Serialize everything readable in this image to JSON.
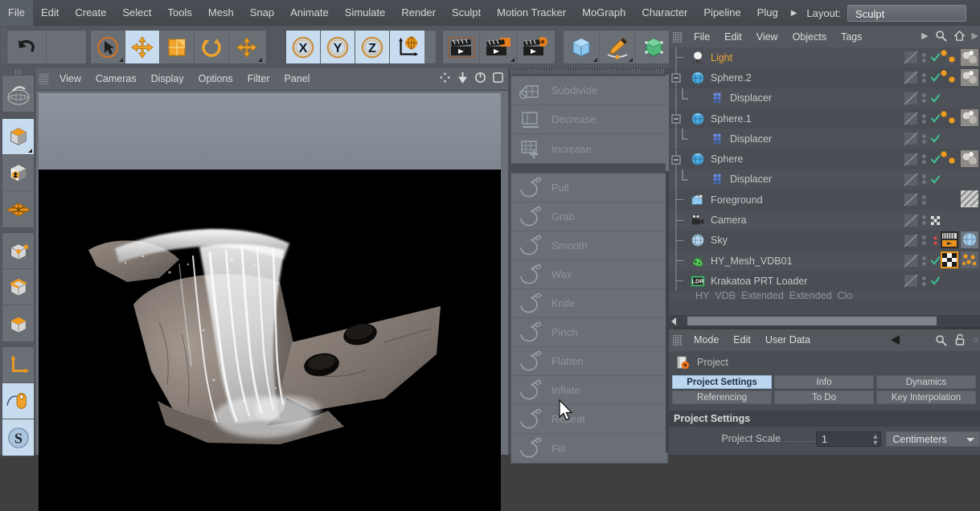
{
  "menubar": {
    "items": [
      "File",
      "Edit",
      "Create",
      "Select",
      "Tools",
      "Mesh",
      "Snap",
      "Animate",
      "Simulate",
      "Render",
      "Sculpt",
      "Motion Tracker",
      "MoGraph",
      "Character",
      "Pipeline",
      "Plug"
    ],
    "overflow_arrow": "▶",
    "layout_label": "Layout:",
    "layout_value": "Sculpt"
  },
  "toolbar": {
    "undo": "undo-arrow",
    "tools": [
      {
        "name": "live-selection-tool",
        "selected": false
      },
      {
        "name": "move-tool",
        "selected": true
      },
      {
        "name": "scale-tool",
        "selected": false
      },
      {
        "name": "rotate-tool",
        "selected": false
      },
      {
        "name": "move-axis-tool",
        "selected": false
      }
    ],
    "axes": [
      {
        "label": "X",
        "active": true
      },
      {
        "label": "Y",
        "active": true
      },
      {
        "label": "Z",
        "active": true
      }
    ],
    "world_axis": "world-coordinate-icon",
    "render_buttons": [
      "render-view",
      "render-region",
      "render-settings"
    ],
    "primitives": [
      "cube-primitive",
      "spline-pen",
      "deformer"
    ]
  },
  "left_toolbar": {
    "items": [
      {
        "name": "make-editable",
        "selected": false
      },
      {
        "name": "model-mode",
        "selected": true
      },
      {
        "name": "texture-mode",
        "selected": false
      },
      {
        "name": "polygon-mode",
        "selected": false
      },
      {
        "name": "point-mode",
        "selected": false
      },
      {
        "name": "edge-mode",
        "selected": false
      },
      {
        "name": "polygon-face-mode",
        "selected": false
      },
      {
        "name": "axis-mode",
        "selected": false
      },
      {
        "name": "viewport-solo",
        "selected": true
      },
      {
        "name": "sculpt-symmetry",
        "selected": true,
        "glyph": "S"
      }
    ]
  },
  "viewport": {
    "menu": [
      "View",
      "Cameras",
      "Display",
      "Options",
      "Filter",
      "Panel"
    ],
    "corner_icons": [
      "pan-icon",
      "move-down-icon",
      "rotate-icon",
      "maximize-icon"
    ],
    "render_description": "rendered waterfall over rocky cliff on black background"
  },
  "sculpt_panel": {
    "groups": [
      {
        "items": [
          {
            "label": "Subdivide",
            "icon": "subdivide-icon"
          },
          {
            "label": "Decrease",
            "icon": "decrease-icon"
          },
          {
            "label": "Increase",
            "icon": "increase-icon"
          }
        ]
      },
      {
        "items": [
          {
            "label": "Pull",
            "icon": "pull-brush-icon"
          },
          {
            "label": "Grab",
            "icon": "grab-brush-icon"
          },
          {
            "label": "Smooth",
            "icon": "smooth-brush-icon"
          },
          {
            "label": "Wax",
            "icon": "wax-brush-icon"
          },
          {
            "label": "Knife",
            "icon": "knife-brush-icon"
          },
          {
            "label": "Pinch",
            "icon": "pinch-brush-icon"
          },
          {
            "label": "Flatten",
            "icon": "flatten-brush-icon"
          },
          {
            "label": "Inflate",
            "icon": "inflate-brush-icon"
          },
          {
            "label": "Repeat",
            "icon": "repeat-brush-icon"
          },
          {
            "label": "Fill",
            "icon": "fill-brush-icon"
          }
        ]
      }
    ]
  },
  "object_manager": {
    "menu": [
      "File",
      "Edit",
      "View",
      "Objects",
      "Tags"
    ],
    "overflow_arrow": "▶",
    "icons": [
      "search-icon",
      "home-icon"
    ],
    "objects": [
      {
        "label": "Light",
        "icon": "light-icon",
        "depth": 0,
        "expandable": false,
        "highlight": true,
        "visdots": true,
        "check": "green",
        "tags": [
          "material-orange",
          "texture-thumb"
        ]
      },
      {
        "label": "Sphere.2",
        "icon": "sphere-icon",
        "depth": 0,
        "expandable": true,
        "highlight": false,
        "visdots": true,
        "check": "green",
        "tags": [
          "material-orange",
          "texture-thumb"
        ]
      },
      {
        "label": "Displacer",
        "icon": "displacer-icon",
        "depth": 1,
        "expandable": false,
        "highlight": false,
        "visdots": true,
        "check": "green",
        "tags": []
      },
      {
        "label": "Sphere.1",
        "icon": "sphere-icon",
        "depth": 0,
        "expandable": true,
        "highlight": false,
        "visdots": true,
        "check": "green",
        "tags": [
          "material-orange",
          "texture-thumb"
        ]
      },
      {
        "label": "Displacer",
        "icon": "displacer-icon",
        "depth": 1,
        "expandable": false,
        "highlight": false,
        "visdots": true,
        "check": "green",
        "tags": []
      },
      {
        "label": "Sphere",
        "icon": "sphere-icon",
        "depth": 0,
        "expandable": true,
        "highlight": false,
        "visdots": true,
        "check": "green",
        "tags": [
          "material-orange",
          "texture-thumb"
        ]
      },
      {
        "label": "Displacer",
        "icon": "displacer-icon",
        "depth": 1,
        "expandable": false,
        "highlight": false,
        "visdots": true,
        "check": "green",
        "tags": []
      },
      {
        "label": "Foreground",
        "icon": "foreground-icon",
        "depth": 0,
        "expandable": false,
        "highlight": false,
        "visdots": true,
        "check": "none",
        "tags": [
          "hatch-thumb"
        ]
      },
      {
        "label": "Camera",
        "icon": "camera-icon",
        "depth": 0,
        "expandable": false,
        "highlight": false,
        "visdots": true,
        "check": "dots",
        "tags": []
      },
      {
        "label": "Sky",
        "icon": "sky-icon",
        "depth": 0,
        "expandable": false,
        "highlight": false,
        "visdots": true,
        "check": "red",
        "tags": [
          "compositing-tag",
          "sky-thumb"
        ]
      },
      {
        "label": "HY_Mesh_VDB01",
        "icon": "vdb-mesh-icon",
        "depth": 0,
        "expandable": false,
        "highlight": false,
        "visdots": true,
        "check": "green",
        "tags": [
          "checker-thumb",
          "particle-thumb"
        ]
      },
      {
        "label": "Krakatoa PRT Loader",
        "icon": "prt-loader-icon",
        "depth": 0,
        "expandable": false,
        "highlight": false,
        "visdots": true,
        "check": "green",
        "tags": []
      }
    ]
  },
  "attributes": {
    "menu": [
      "Mode",
      "Edit",
      "User Data"
    ],
    "icons": [
      "back-arrow-icon",
      "forward-arrow-icon",
      "search-icon",
      "lock-icon"
    ],
    "object_title": "Project",
    "object_icon": "project-icon",
    "tabs_row1": [
      {
        "label": "Project Settings",
        "active": true
      },
      {
        "label": "Info",
        "active": false
      },
      {
        "label": "Dynamics",
        "active": false
      }
    ],
    "tabs_row2": [
      {
        "label": "Referencing",
        "active": false
      },
      {
        "label": "To Do",
        "active": false
      },
      {
        "label": "Key Interpolation",
        "active": false
      }
    ],
    "section_header": "Project Settings",
    "properties": [
      {
        "label": "Project Scale",
        "value": "1",
        "unit": "Centimeters"
      }
    ]
  },
  "colors": {
    "accent_orange": "#e8931e",
    "accent_blue": "#bcd6f0",
    "panel_bg": "#4a4e54",
    "toolbar_bg": "#54585e",
    "highlight_text": "#e8a33a",
    "check_green": "#3fbf8f",
    "check_red": "#d84a4a"
  }
}
